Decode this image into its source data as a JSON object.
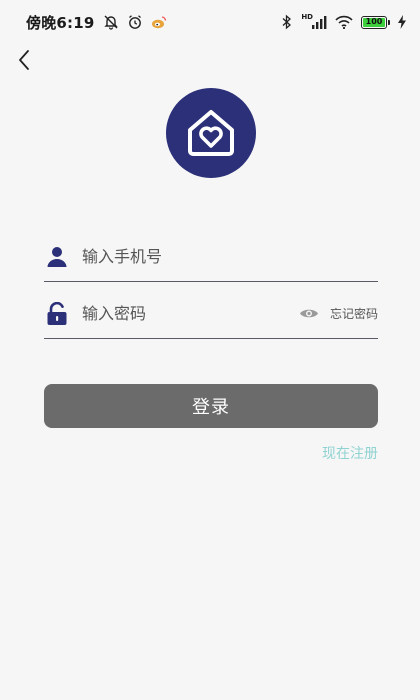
{
  "status_bar": {
    "time_label": "傍晚6:19",
    "battery_label": "100",
    "network_badge": "HD",
    "icons": [
      "bell-mute-icon",
      "alarm-icon",
      "weibo-icon",
      "bluetooth-icon",
      "signal-icon",
      "wifi-icon",
      "battery-icon",
      "charging-icon"
    ]
  },
  "form": {
    "phone_placeholder": "输入手机号",
    "password_placeholder": "输入密码",
    "forgot_label": "忘记密码"
  },
  "actions": {
    "login_label": "登录",
    "register_label": "现在注册"
  },
  "colors": {
    "brand": "#2c3079",
    "button": "#6b6b6b",
    "register_link": "#8fd3d1",
    "background": "#f6f6f6"
  }
}
